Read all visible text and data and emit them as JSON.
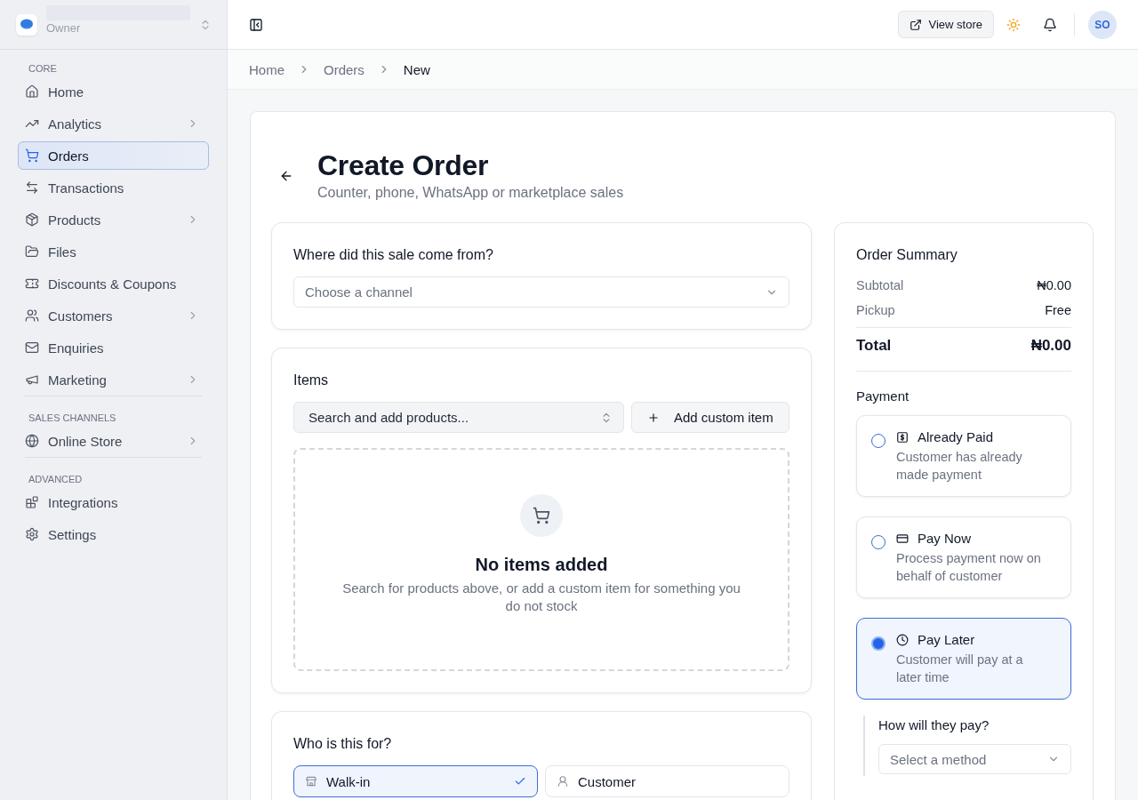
{
  "sidebar": {
    "account": {
      "role": "Owner"
    },
    "sections": [
      {
        "label": "CORE",
        "items": [
          {
            "label": "Home",
            "selected": false,
            "expandable": false
          },
          {
            "label": "Analytics",
            "selected": false,
            "expandable": true
          },
          {
            "label": "Orders",
            "selected": true,
            "expandable": false
          },
          {
            "label": "Transactions",
            "selected": false,
            "expandable": false
          },
          {
            "label": "Products",
            "selected": false,
            "expandable": true
          },
          {
            "label": "Files",
            "selected": false,
            "expandable": false
          },
          {
            "label": "Discounts & Coupons",
            "selected": false,
            "expandable": false
          },
          {
            "label": "Customers",
            "selected": false,
            "expandable": true
          },
          {
            "label": "Enquiries",
            "selected": false,
            "expandable": false
          },
          {
            "label": "Marketing",
            "selected": false,
            "expandable": true
          }
        ]
      },
      {
        "label": "SALES CHANNELS",
        "items": [
          {
            "label": "Online Store",
            "selected": false,
            "expandable": true
          }
        ]
      },
      {
        "label": "ADVANCED",
        "items": [
          {
            "label": "Integrations",
            "selected": false,
            "expandable": false
          },
          {
            "label": "Settings",
            "selected": false,
            "expandable": false
          }
        ]
      }
    ]
  },
  "topbar": {
    "view_store": "View store",
    "avatar": "SO"
  },
  "breadcrumbs": [
    {
      "label": "Home",
      "current": false
    },
    {
      "label": "Orders",
      "current": false
    },
    {
      "label": "New",
      "current": true
    }
  ],
  "page": {
    "title": "Create Order",
    "subtitle": "Counter, phone, WhatsApp or marketplace sales"
  },
  "channel_card": {
    "title": "Where did this sale come from?",
    "select": {
      "placeholder": "Choose a channel"
    }
  },
  "items_card": {
    "title": "Items",
    "search": {
      "label": "Search and add products..."
    },
    "add_button": "Add custom item",
    "empty": {
      "title": "No items added",
      "text": "Search for products above, or add a custom item for something you do not stock"
    }
  },
  "customer_card": {
    "title": "Who is this for?",
    "options": [
      {
        "label": "Walk-in",
        "selected": true
      },
      {
        "label": "Customer",
        "selected": false
      }
    ]
  },
  "summary": {
    "title": "Order Summary",
    "rows": [
      {
        "label": "Subtotal",
        "value": "₦0.00"
      },
      {
        "label": "Pickup",
        "value": "Free"
      }
    ],
    "total": {
      "label": "Total",
      "value": "₦0.00"
    },
    "payment": {
      "title": "Payment",
      "options": [
        {
          "label": "Already Paid",
          "description": "Customer has already made payment",
          "selected": false
        },
        {
          "label": "Pay Now",
          "description": "Process payment now on behalf of customer",
          "selected": false
        },
        {
          "label": "Pay Later",
          "description": "Customer will pay at a later time",
          "selected": true
        }
      ],
      "method": {
        "label": "How will they pay?",
        "placeholder": "Select a method"
      }
    }
  }
}
